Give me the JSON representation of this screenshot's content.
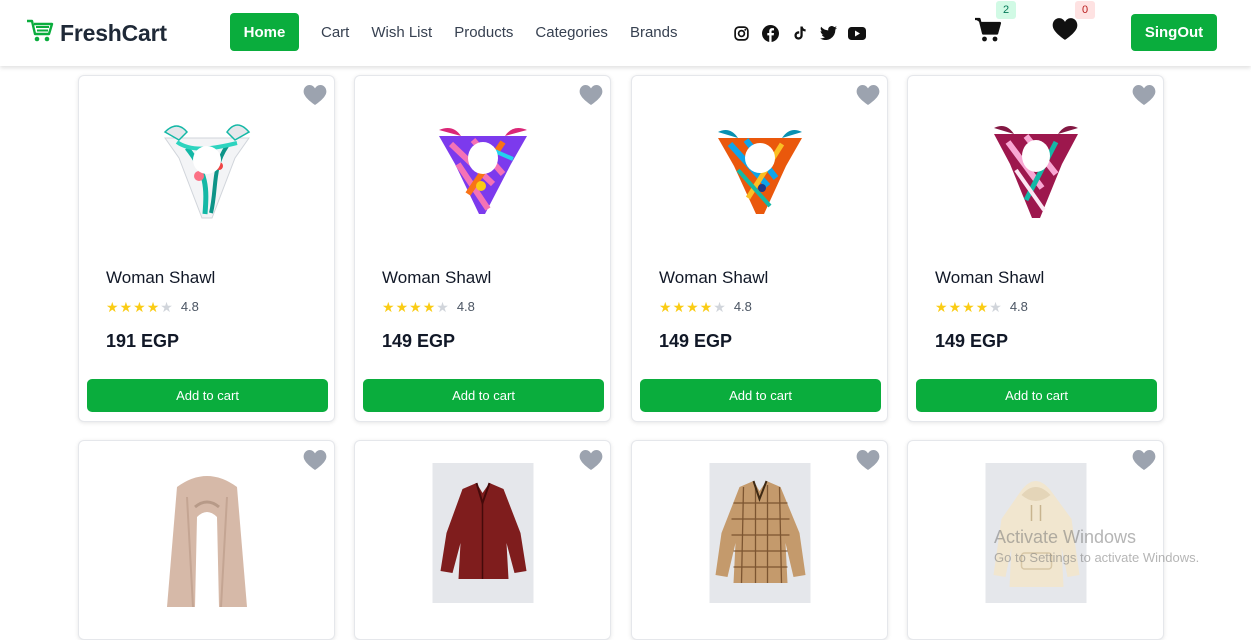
{
  "brand": {
    "name": "FreshCart",
    "accent_color": "#0aad3d",
    "logo_icon": "cart-logo-icon"
  },
  "nav": {
    "home": "Home",
    "links": [
      "Cart",
      "Wish List",
      "Products",
      "Categories",
      "Brands"
    ],
    "socials": [
      "instagram-icon",
      "facebook-icon",
      "tiktok-icon",
      "twitter-icon",
      "youtube-icon"
    ],
    "cart_count": "2",
    "wishlist_count": "0",
    "signout": "SingOut"
  },
  "products": [
    {
      "title": "Woman Shawl",
      "rating": "4.8",
      "rating_value": 4.8,
      "price": "191 EGP",
      "add_label": "Add to cart"
    },
    {
      "title": "Woman Shawl",
      "rating": "4.8",
      "rating_value": 4.8,
      "price": "149 EGP",
      "add_label": "Add to cart"
    },
    {
      "title": "Woman Shawl",
      "rating": "4.8",
      "rating_value": 4.8,
      "price": "149 EGP",
      "add_label": "Add to cart"
    },
    {
      "title": "Woman Shawl",
      "rating": "4.8",
      "rating_value": 4.8,
      "price": "149 EGP",
      "add_label": "Add to cart"
    },
    {
      "image": "beige-scarf"
    },
    {
      "image": "burgundy-shirt"
    },
    {
      "image": "plaid-shirt"
    },
    {
      "image": "cream-hoodie"
    }
  ],
  "watermark": {
    "line1": "Activate Windows",
    "line2": "Go to Settings to activate Windows."
  }
}
